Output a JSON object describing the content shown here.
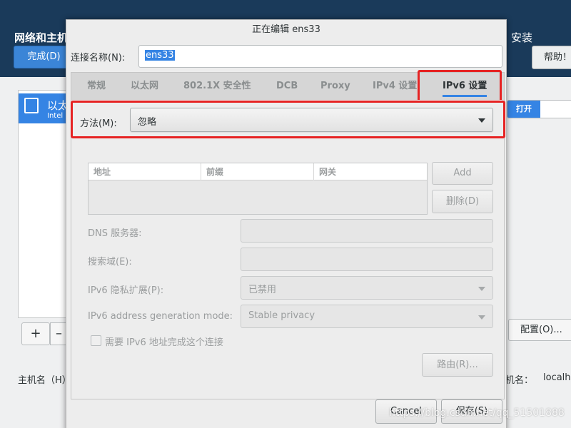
{
  "background": {
    "header_title": "网络和主机",
    "done_button": "完成(D)",
    "install_title": "安装",
    "help_button": "帮助！",
    "connection_name": "以太",
    "connection_sub": "Intel",
    "add_button": "+",
    "remove_button": "–",
    "toggle_label": "打开",
    "configure_button": "配置(O)...",
    "hostname_label": "主机名（H）",
    "current_hostname_label": "机名：",
    "current_hostname_value": "localho"
  },
  "dialog": {
    "title": "正在编辑 ens33",
    "connection_name_label": "连接名称(N):",
    "connection_name_value": "ens33",
    "tabs": [
      {
        "label": "常规"
      },
      {
        "label": "以太网"
      },
      {
        "label": "802.1X 安全性"
      },
      {
        "label": "DCB"
      },
      {
        "label": "Proxy"
      },
      {
        "label": "IPv4 设置"
      },
      {
        "label": "IPv6 设置",
        "active": true
      }
    ],
    "method_label": "方法(M):",
    "method_value": "忽略",
    "address_table": {
      "columns": [
        "地址",
        "前缀",
        "网关"
      ],
      "rows": []
    },
    "add_button": "Add",
    "delete_button": "删除(D)",
    "dns_label": "DNS 服务器:",
    "search_domain_label": "搜索域(E):",
    "privacy_label": "IPv6 隐私扩展(P):",
    "privacy_value": "已禁用",
    "addr_gen_label": "IPv6 address generation mode:",
    "addr_gen_value": "Stable privacy",
    "require_ipv6_label": "需要 IPv6 地址完成这个连接",
    "require_ipv6_checked": false,
    "routes_button": "路由(R)...",
    "cancel_button": "Cancel",
    "save_button": "保存(S)"
  },
  "watermark": "https://blog.csdn.net/qq_51501888",
  "colors": {
    "accent": "#3584e4",
    "highlight_annotation": "#e62323"
  }
}
